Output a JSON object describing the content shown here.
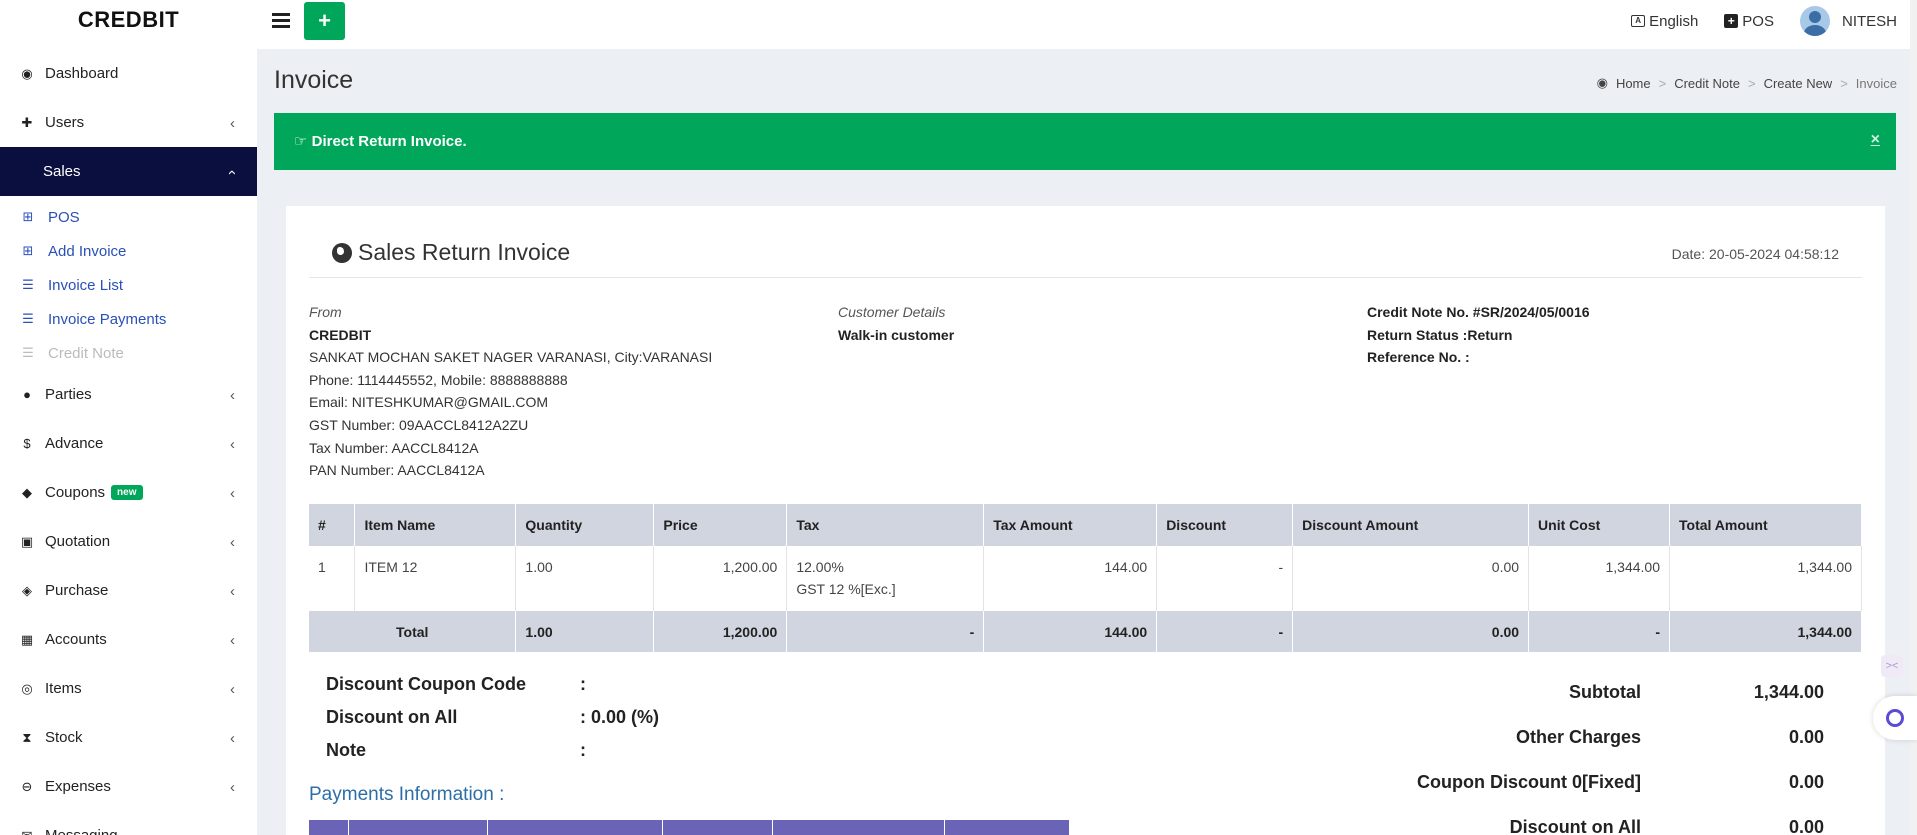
{
  "brand": "CREDBIT",
  "topbar": {
    "language": "English",
    "pos": "POS",
    "user": "NITESH",
    "add_label": "+"
  },
  "sidebar": {
    "items": [
      {
        "label": "Dashboard",
        "icon": "dashboard-icon",
        "glyph": "◉"
      },
      {
        "label": "Users",
        "icon": "users-icon",
        "glyph": "✚"
      },
      {
        "label": "Sales",
        "icon": "sales-icon",
        "glyph": ""
      },
      {
        "label": "Parties",
        "icon": "parties-icon",
        "glyph": "●"
      },
      {
        "label": "Advance",
        "icon": "dollar-icon",
        "glyph": "$"
      },
      {
        "label": "Coupons",
        "icon": "tags-icon",
        "glyph": "◆",
        "badge": "new"
      },
      {
        "label": "Quotation",
        "icon": "calendar-icon",
        "glyph": "▣"
      },
      {
        "label": "Purchase",
        "icon": "cube-icon",
        "glyph": "◈"
      },
      {
        "label": "Accounts",
        "icon": "th-large-icon",
        "glyph": "▦"
      },
      {
        "label": "Items",
        "icon": "cubes-icon",
        "glyph": "◎"
      },
      {
        "label": "Stock",
        "icon": "hourglass-icon",
        "glyph": "⧗"
      },
      {
        "label": "Expenses",
        "icon": "minus-circle-icon",
        "glyph": "⊖"
      },
      {
        "label": "Messaging",
        "icon": "messaging-icon",
        "glyph": "✉"
      }
    ],
    "sales_sub": [
      {
        "label": "POS",
        "glyph": "⊞"
      },
      {
        "label": "Add Invoice",
        "glyph": "⊞"
      },
      {
        "label": "Invoice List",
        "glyph": "☰"
      },
      {
        "label": "Invoice Payments",
        "glyph": "☰"
      },
      {
        "label": "Credit Note",
        "glyph": "☰"
      }
    ]
  },
  "page": {
    "title": "Invoice"
  },
  "breadcrumb": [
    "Home",
    "Credit Note",
    "Create New",
    "Invoice"
  ],
  "alert": {
    "text": "Direct Return Invoice.",
    "close": "×"
  },
  "invoice": {
    "title": "Sales Return Invoice",
    "date": "Date: 20-05-2024 04:58:12",
    "from_label": "From",
    "company": "CREDBIT",
    "address": "SANKAT MOCHAN SAKET NAGER VARANASI, City:VARANASI",
    "phone": "Phone: 1114445552, Mobile: 8888888888",
    "email": "Email: NITESHKUMAR@GMAIL.COM",
    "gst": "GST Number: 09AACCL8412A2ZU",
    "tax": "Tax Number: AACCL8412A",
    "pan": "PAN Number: AACCL8412A",
    "customer_label": "Customer Details",
    "customer": "Walk-in customer",
    "credit_note": "Credit Note No. #SR/2024/05/0016",
    "return_status": "Return Status :Return",
    "reference": "Reference No. :"
  },
  "table": {
    "headers": [
      "#",
      "Item Name",
      "Quantity",
      "Price",
      "Tax",
      "Tax Amount",
      "Discount",
      "Discount Amount",
      "Unit Cost",
      "Total Amount"
    ],
    "row": {
      "num": "1",
      "name": "ITEM 12",
      "qty": "1.00",
      "price": "1,200.00",
      "tax1": "12.00%",
      "tax2": "GST 12 %[Exc.]",
      "tax_amount": "144.00",
      "discount": "-",
      "discount_amount": "0.00",
      "unit_cost": "1,344.00",
      "total": "1,344.00"
    },
    "total": {
      "label": "Total",
      "qty": "1.00",
      "price": "1,200.00",
      "tax": "-",
      "tax_amount": "144.00",
      "discount": "-",
      "discount_amount": "0.00",
      "unit_cost": "-",
      "total": "1,344.00"
    }
  },
  "extra": {
    "coupon_label": "Discount Coupon Code",
    "coupon_val": ":",
    "disc_label": "Discount on All",
    "disc_val": ": 0.00 (%)",
    "note_label": "Note",
    "note_val": ":"
  },
  "payments": {
    "title": "Payments Information :"
  },
  "totals": {
    "subtotal_label": "Subtotal",
    "subtotal": "1,344.00",
    "other_label": "Other Charges",
    "other": "0.00",
    "coupon_label": "Coupon Discount 0[Fixed]",
    "coupon": "0.00",
    "disc_label": "Discount on All",
    "disc": "0.00"
  }
}
